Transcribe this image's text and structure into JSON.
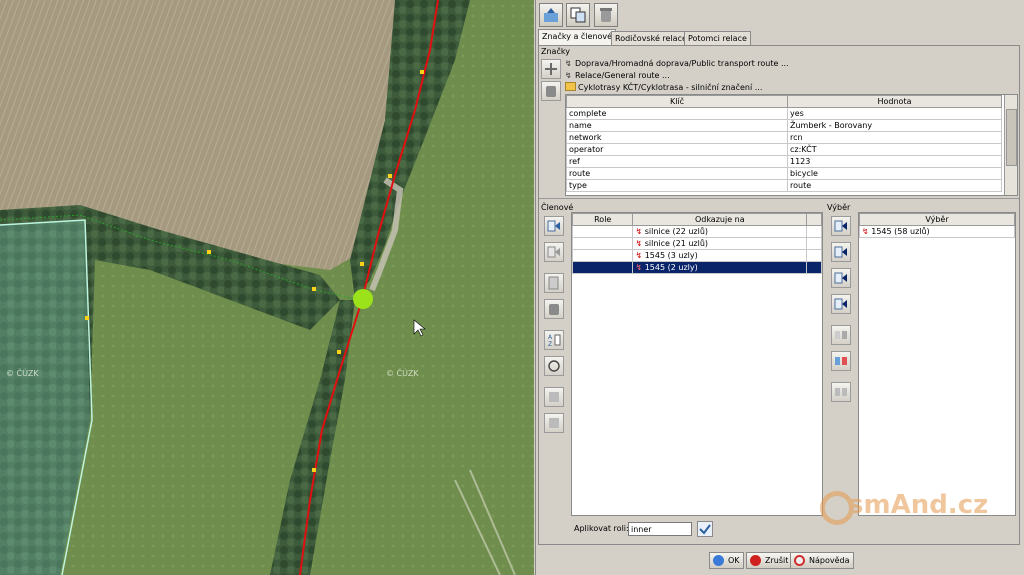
{
  "map": {
    "watermark_left": "© ČÚZK",
    "watermark_right": "© ČÚZK"
  },
  "tabs": [
    {
      "label": "Značky a členové",
      "active": true
    },
    {
      "label": "Rodičovské relace",
      "active": false
    },
    {
      "label": "Potomci relace",
      "active": false
    }
  ],
  "tags_section": {
    "title": "Značky",
    "presets": [
      "Doprava/Hromadná doprava/Public transport route ...",
      "Relace/General route ...",
      "Cyklotrasy KČT/Cyklotrasa - silniční značení ..."
    ],
    "columns": [
      "Klíč",
      "Hodnota"
    ],
    "rows": [
      {
        "key": "complete",
        "value": "yes"
      },
      {
        "key": "name",
        "value": "Žumberk - Borovany"
      },
      {
        "key": "network",
        "value": "rcn"
      },
      {
        "key": "operator",
        "value": "cz:KČT"
      },
      {
        "key": "ref",
        "value": "1123"
      },
      {
        "key": "route",
        "value": "bicycle"
      },
      {
        "key": "type",
        "value": "route"
      }
    ]
  },
  "members_section": {
    "title": "Členové",
    "columns": [
      "Role",
      "Odkazuje na"
    ],
    "rows": [
      {
        "role": "",
        "ref": "silnice (22 uzlů)",
        "selected": false
      },
      {
        "role": "",
        "ref": "silnice (21 uzlů)",
        "selected": false
      },
      {
        "role": "",
        "ref": "1545 (3 uzly)",
        "selected": false
      },
      {
        "role": "",
        "ref": "1545 (2 uzly)",
        "selected": true
      }
    ],
    "apply_role_label": "Aplikovat roli:",
    "apply_role_value": "inner"
  },
  "selection_section": {
    "title": "Výběr",
    "column": "Výběr",
    "rows": [
      "1545 (58 uzlů)"
    ]
  },
  "buttons": {
    "ok": "OK",
    "cancel": "Zrušit",
    "help": "Nápověda"
  },
  "watermark": "smAnd.cz",
  "colors": {
    "route": "#e01010",
    "selection": "#0a246a",
    "node": "#ffd21a",
    "highlight": "#9be21a"
  }
}
